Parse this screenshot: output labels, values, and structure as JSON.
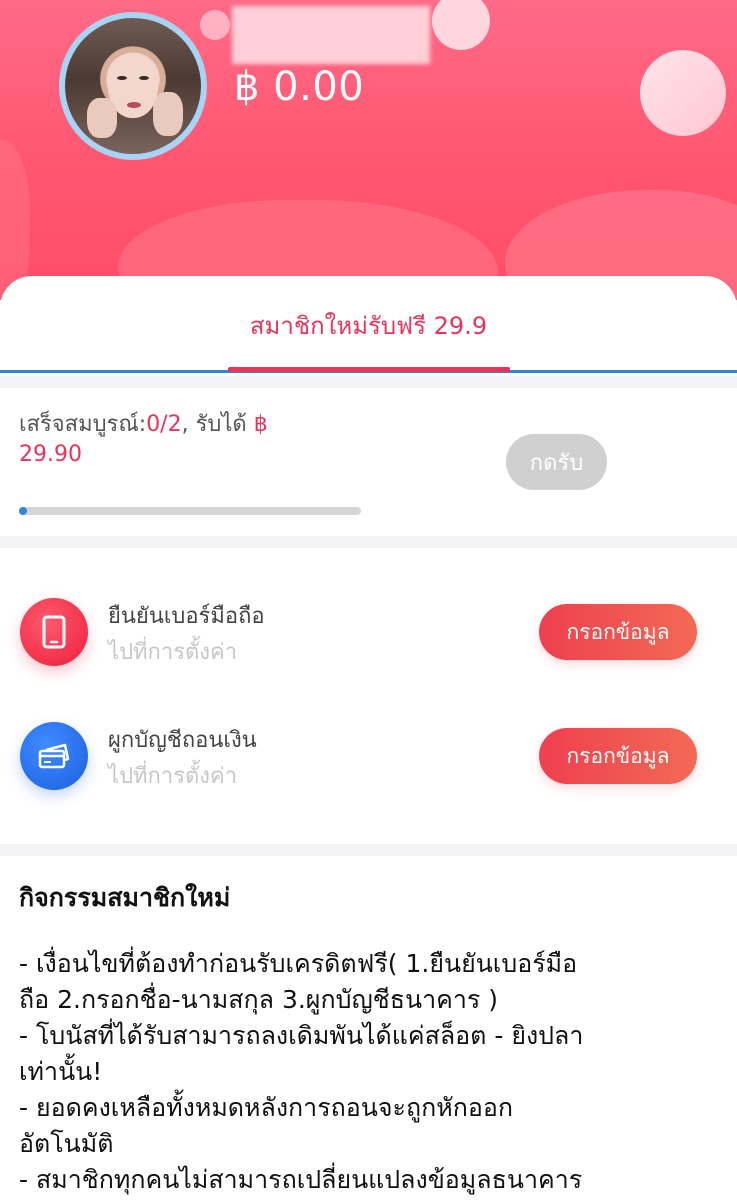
{
  "header": {
    "balance": "฿ 0.00",
    "colors": {
      "accent": "#e8345a",
      "header_bg": "#ff5a72"
    }
  },
  "tab": {
    "label": "สมาชิกใหม่รับฟรี 29.9"
  },
  "progress": {
    "status_prefix": "เสร็จสมบูรณ์:",
    "status_count": "0/2",
    "receive_text": ", รับได้ ",
    "currency": "฿",
    "amount": "29.90",
    "claim_label": "กดรับ",
    "completed_fraction": 0.0
  },
  "tasks": [
    {
      "title": "ยืนยันเบอร์มือถือ",
      "subtitle": "ไปที่การตั้งค่า",
      "button": "กรอกข้อมูล",
      "icon": "phone-icon"
    },
    {
      "title": "ผูกบัญชีถอนเงิน",
      "subtitle": "ไปที่การตั้งค่า",
      "button": "กรอกข้อมูล",
      "icon": "card-icon"
    }
  ],
  "info": {
    "title": "กิจกรรมสมาชิกใหม่",
    "lines": [
      "- เงื่อนไขที่ต้องทำก่อนรับเครดิตฟรี( 1.ยืนยันเบอร์มือ",
      "ถือ  2.กรอกชื่อ-นามสกุล  3.ผูกบัญชีธนาคาร )",
      "- โบนัสที่ได้รับสามารถลงเดิมพันได้แค่สล็อต - ยิงปลา",
      "เท่านั้น!",
      "- ยอดคงเหลือทั้งหมดหลังการถอนจะถูกหักออก",
      "อัตโนมัติ",
      "- สมาชิกทุกคนไม่สามารถเปลี่ยนแปลงข้อมูลธนาคาร"
    ]
  }
}
